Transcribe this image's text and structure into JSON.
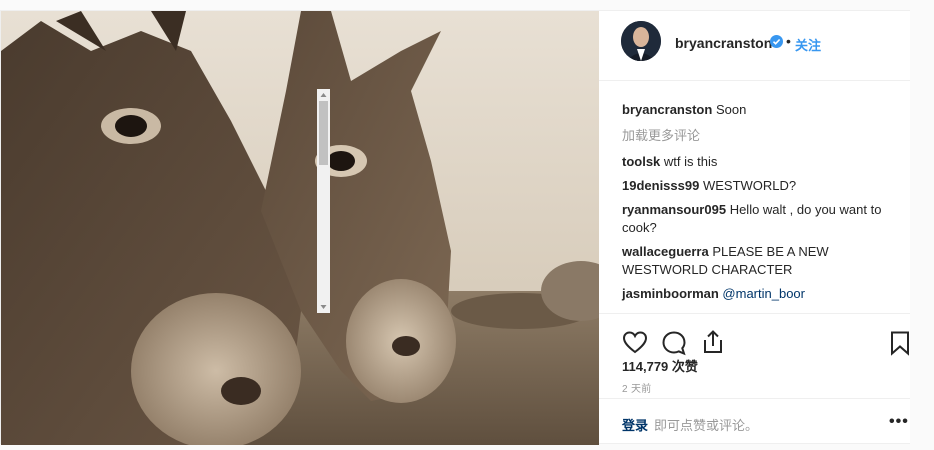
{
  "post": {
    "username": "bryancranston",
    "dot": "•",
    "follow_label": "关注",
    "image_alt_icon": "donkeys-photo"
  },
  "comments": [
    {
      "user": "bryancranston",
      "text": "Soon"
    },
    {
      "load_more": "加载更多评论"
    },
    {
      "user": "toolsk",
      "text": "wtf is this"
    },
    {
      "user": "19denisss99",
      "text": "WESTWORLD?"
    },
    {
      "user": "ryanmansour095",
      "text": "Hello walt , do you want to cook?"
    },
    {
      "user": "wallaceguerra",
      "text": "PLEASE BE A NEW WESTWORLD CHARACTER"
    },
    {
      "user": "jasminboorman",
      "text": "@martin_boor"
    }
  ],
  "stats": {
    "likes": "114,779 次赞",
    "time": "2 天前"
  },
  "login": {
    "link": "登录",
    "text": "即可点赞或评论。",
    "more": "•••"
  },
  "icons": {
    "like": "heart-icon",
    "comment": "comment-icon",
    "share": "share-icon",
    "save": "bookmark-icon",
    "verified": "verified-badge-icon"
  },
  "colors": {
    "link": "#3897f0",
    "muted": "#999999",
    "text": "#262626",
    "border": "#efefef"
  }
}
